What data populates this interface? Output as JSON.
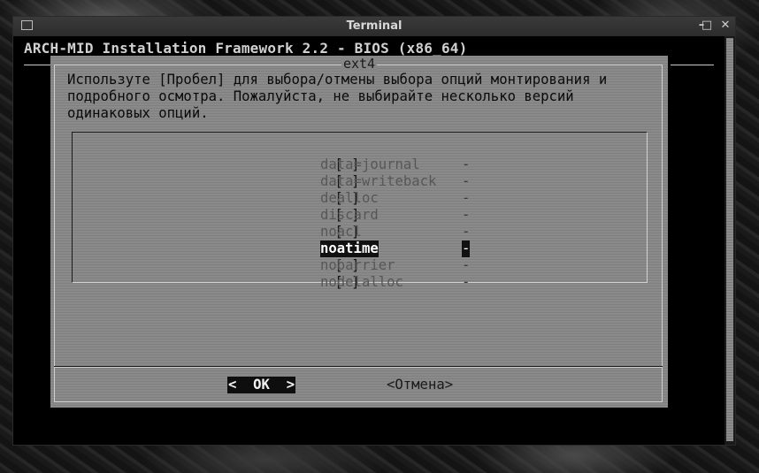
{
  "window": {
    "title": "Terminal",
    "buttons": {
      "minimize": "–",
      "maximize": "□",
      "close": "✕"
    }
  },
  "terminal": {
    "backtitle": "ARCH-MID Installation Framework 2.2 - BIOS (x86_64)"
  },
  "dialog": {
    "title": "ext4",
    "message": "Используте [Пробел] для выбора/отмены выбора опций монтирования и\nподробного осмотра. Пожалуйста, не выбирайте несколько версий\nодинаковых опций.",
    "items": [
      {
        "checkbox": "[ ]",
        "name": "data=journal",
        "desc": "-",
        "selected": false
      },
      {
        "checkbox": "[ ]",
        "name": "data=writeback",
        "desc": "-",
        "selected": false
      },
      {
        "checkbox": "[ ]",
        "name": "dealloc",
        "desc": "-",
        "selected": false
      },
      {
        "checkbox": "[ ]",
        "name": "discard",
        "desc": "-",
        "selected": false
      },
      {
        "checkbox": "[ ]",
        "name": "noacl",
        "desc": "-",
        "selected": false
      },
      {
        "checkbox": "[*]",
        "name": "noatime",
        "desc": "-",
        "selected": true
      },
      {
        "checkbox": "[ ]",
        "name": "nobarrier",
        "desc": "-",
        "selected": false
      },
      {
        "checkbox": "[ ]",
        "name": "nodelalloc",
        "desc": "-",
        "selected": false
      }
    ],
    "ok_label": "<  OK  >",
    "cancel_label": "<Отмена>"
  }
}
